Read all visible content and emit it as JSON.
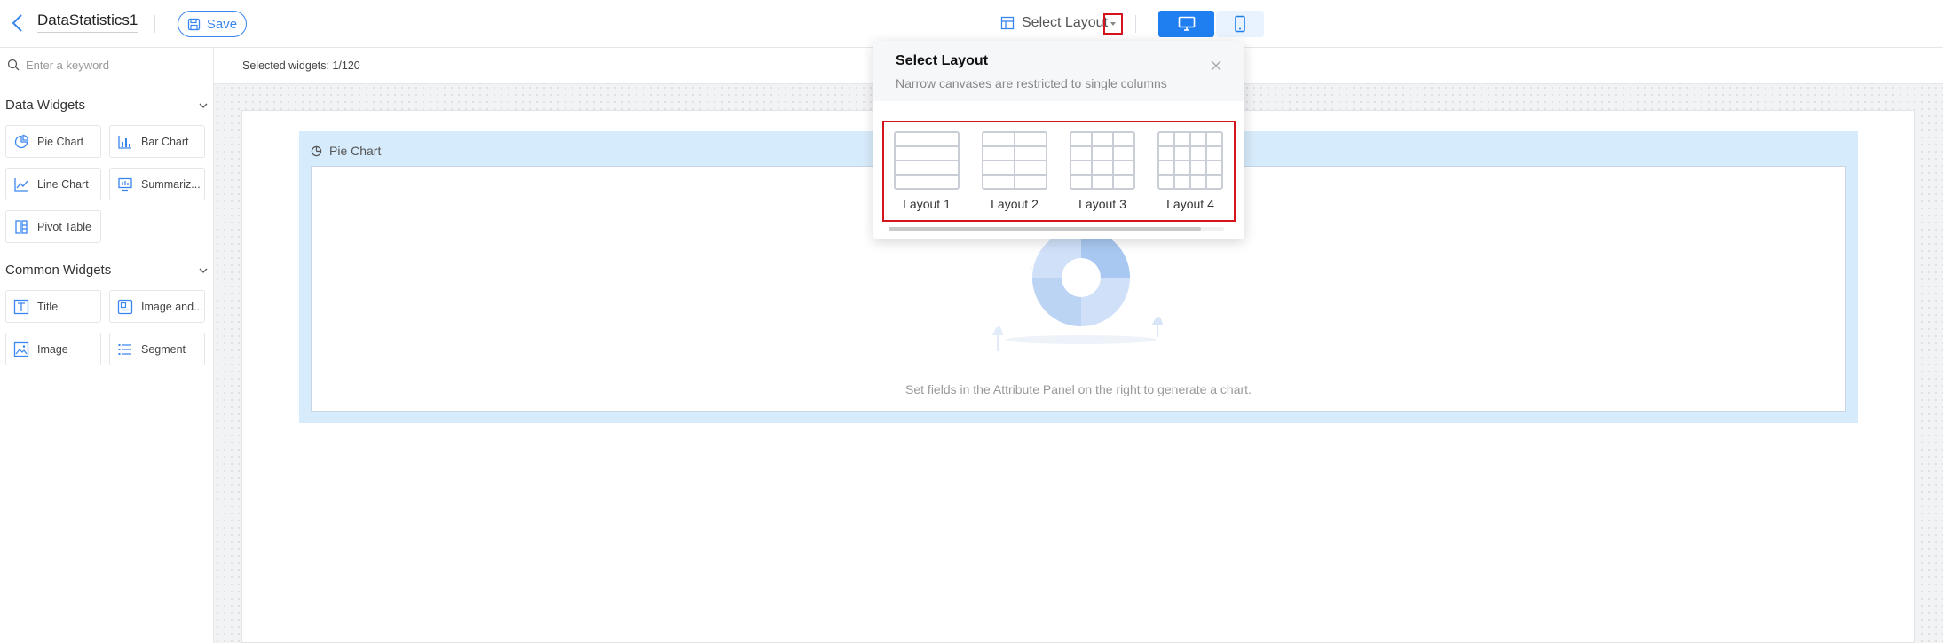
{
  "header": {
    "title": "DataStatistics1",
    "save_label": "Save",
    "layout_label": "Select Layout"
  },
  "sidebar": {
    "search_placeholder": "Enter a keyword",
    "sections": [
      {
        "title": "Data Widgets",
        "widgets": [
          {
            "label": "Pie Chart",
            "icon": "pie-chart-icon"
          },
          {
            "label": "Bar Chart",
            "icon": "bar-chart-icon"
          },
          {
            "label": "Line Chart",
            "icon": "line-chart-icon"
          },
          {
            "label": "Summariz...",
            "icon": "summary-icon"
          },
          {
            "label": "Pivot Table",
            "icon": "pivot-table-icon"
          }
        ]
      },
      {
        "title": "Common Widgets",
        "widgets": [
          {
            "label": "Title",
            "icon": "title-icon"
          },
          {
            "label": "Image and...",
            "icon": "image-text-icon"
          },
          {
            "label": "Image",
            "icon": "image-icon"
          },
          {
            "label": "Segment",
            "icon": "segment-icon"
          }
        ]
      }
    ]
  },
  "toolbar": {
    "selected_widgets": "Selected widgets: 1/120"
  },
  "canvas": {
    "widget_title": "Pie Chart",
    "empty_message": "Set fields in the Attribute Panel on the right to generate a chart."
  },
  "popover": {
    "title": "Select Layout",
    "subtitle": "Narrow canvases are restricted to single columns",
    "layouts": [
      {
        "label": "Layout 1"
      },
      {
        "label": "Layout 2"
      },
      {
        "label": "Layout 3"
      },
      {
        "label": "Layout 4"
      }
    ]
  },
  "colors": {
    "accent": "#1f7ff0",
    "highlight": "#d4141b",
    "widget_bg": "#d6ebfb"
  }
}
